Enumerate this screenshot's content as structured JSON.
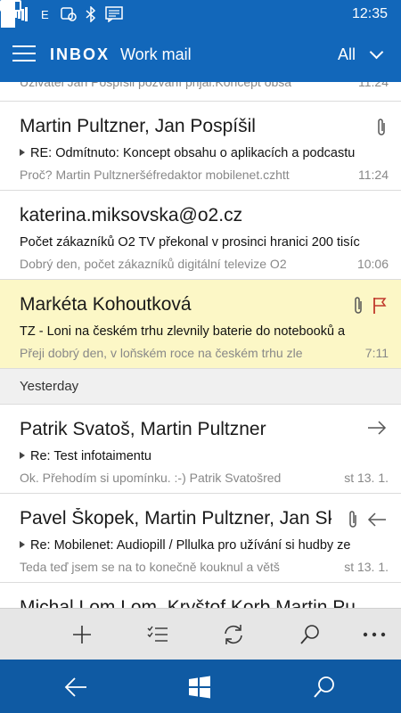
{
  "statusbar": {
    "network": "E",
    "time": "12:35"
  },
  "header": {
    "title": "INBOX",
    "account": "Work mail",
    "filter": "All"
  },
  "partial_top": {
    "preview": "Uživatel Jan Pospíšil pozvání přijal:Koncept obsa",
    "time": "11:24"
  },
  "mails_today": [
    {
      "sender": "Martin Pultzner, Jan Pospíšil",
      "subject": "RE: Odmítnuto: Koncept obsahu o aplikacích a podcastu",
      "preview": "Proč? Martin Pultzneršéfredaktor mobilenet.czhtt",
      "time": "11:24"
    },
    {
      "sender": "katerina.miksovska@o2.cz",
      "subject": "Počet zákazníků O2 TV překonal v prosinci hranici 200 tisíc",
      "preview": "Dobrý den, počet zákazníků digitální televize O2",
      "time": "10:06"
    },
    {
      "sender": "Markéta Kohoutková",
      "subject": "TZ - Loni na českém trhu zlevnily baterie do notebooků a",
      "preview": "Přeji dobrý den, v loňském roce na českém trhu zle",
      "time": "7:11"
    }
  ],
  "group_yesterday": "Yesterday",
  "mails_yesterday": [
    {
      "sender": "Patrik Svatoš, Martin Pultzner",
      "subject": "Re: Test infotaimentu",
      "preview": "Ok. Přehodím si upomínku. :-) Patrik Svatošred",
      "time": "st 13. 1."
    },
    {
      "sender": "Pavel Škopek, Martin Pultzner, Jan Sk",
      "subject": "Re: Mobilenet: Audiopill / Pllulka pro užívání si hudby ze",
      "preview": "Teda teď jsem se na to konečně kouknul a větš",
      "time": "st 13. 1."
    },
    {
      "sender": "Michal Lom Lom, Kryštof Korb      Martin Pu"
    }
  ],
  "colors": {
    "accent": "#1267ba",
    "navbar": "#0f5aa3",
    "highlight": "#fcf7c6",
    "flag": "#c0392b"
  },
  "icons": {
    "commandbar": [
      "plus-icon",
      "select-icon",
      "sync-icon",
      "search-icon",
      "more-icon"
    ],
    "navbar": [
      "back-icon",
      "windows-icon",
      "search-icon"
    ]
  }
}
